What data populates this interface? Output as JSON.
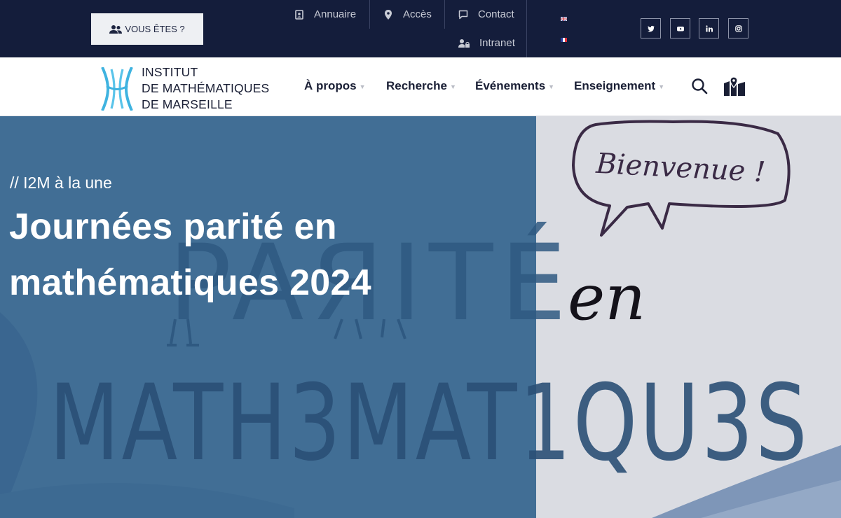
{
  "topbar": {
    "vous_etes": "VOUS ÊTES ?",
    "links": {
      "annuaire": "Annuaire",
      "acces": "Accès",
      "contact": "Contact",
      "intranet": "Intranet"
    },
    "languages": [
      "en",
      "fr"
    ],
    "social": [
      "twitter-icon",
      "youtube-icon",
      "linkedin-icon",
      "instagram-icon"
    ]
  },
  "logo": {
    "line1": "INSTITUT",
    "line2": "DE MATHÉMATIQUES",
    "line3": "DE MARSEILLE"
  },
  "nav": {
    "items": [
      {
        "label": "À propos"
      },
      {
        "label": "Recherche"
      },
      {
        "label": "Événements"
      },
      {
        "label": "Enseignement"
      }
    ]
  },
  "hero": {
    "kicker": "// I2M à la une",
    "title": "Journées parité en mathématiques 2024",
    "artwork_text": {
      "speech_bubble": "Bienvenue !",
      "line1": "PAЯITÉ",
      "line2": "en",
      "line3": "MATH3MAT1QU3S"
    }
  },
  "colors": {
    "topbar_bg": "#141d3b",
    "hero_blue": "#416e95",
    "logo_cyan": "#3fb3e0"
  }
}
